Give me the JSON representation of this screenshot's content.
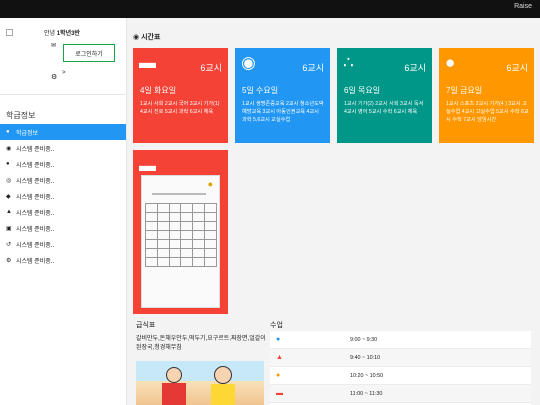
{
  "topbar": {
    "brand": "Raise"
  },
  "sidebar": {
    "greeting_prefix": "안녕 ",
    "greeting_bold": "1학년3반",
    "login_label": "로그인하기",
    "chevron": ">",
    "section_title": "학급정보",
    "menu": [
      {
        "label": "학급정보",
        "icon": "users-icon",
        "glyph": "●",
        "active": true
      },
      {
        "label": "시스템 준비중..",
        "icon": "eye-icon",
        "glyph": "◉"
      },
      {
        "label": "시스템 준비중..",
        "icon": "users-icon",
        "glyph": "●"
      },
      {
        "label": "시스템 준비중..",
        "icon": "compass-icon",
        "glyph": "◎"
      },
      {
        "label": "시스템 준비중..",
        "icon": "diamond-icon",
        "glyph": "◆"
      },
      {
        "label": "시스템 준비중..",
        "icon": "bell-icon",
        "glyph": "▲"
      },
      {
        "label": "시스템 준비중..",
        "icon": "bank-icon",
        "glyph": "▣"
      },
      {
        "label": "시스템 준비중..",
        "icon": "history-icon",
        "glyph": "↺"
      },
      {
        "label": "시스템 준비중..",
        "icon": "gear-icon",
        "glyph": "⚙"
      }
    ]
  },
  "main": {
    "title": "시간표",
    "cards": [
      {
        "color": "#f44336",
        "icon": "comment-icon",
        "glyph": "▬",
        "periods": "6교시",
        "day": "4일 화요일",
        "detail": "1교시 사회 2교시 국어 3교시 기가(1) 4교시 진로 5교시 과학 6교시 체육"
      },
      {
        "color": "#2196f3",
        "icon": "eye-icon",
        "glyph": "◉",
        "periods": "6교시",
        "day": "5일 수요일",
        "detail": "1교시 생명존중교육 2교시 청소년도박예방교육 3교시 아동인권교육 4교시 과학 5,6교시 교실수업"
      },
      {
        "color": "#009688",
        "icon": "share-icon",
        "glyph": "∴",
        "periods": "6교시",
        "day": "6일 목요일",
        "detail": "1교시 기가(2) 2교시 사회 3교시 독서 4교시 영어 5교시 수학 6교시 체육"
      },
      {
        "color": "#ff9800",
        "icon": "users-icon",
        "glyph": "●",
        "periods": "6교시",
        "day": "7일 금요일",
        "detail": "1교시 스포츠 2교시 기가(4 ) 3교시 고실수업 4교시 고실수업 5교시 수학 6교시 수학 7교시 담임시간"
      }
    ],
    "lunch": {
      "title": "급식표",
      "menu": "갈비만두,돈채우만두,떡두기,요구르트,짜장면,얼갈이된장국,청경채무침"
    },
    "classes": {
      "title": "수업",
      "items": [
        {
          "time": "9:00 ~ 9:30",
          "icon": "user-icon",
          "glyph": "●",
          "color": "#2196f3"
        },
        {
          "time": "9:40 ~ 10:10",
          "icon": "bell-icon",
          "glyph": "▲",
          "color": "#f44336"
        },
        {
          "time": "10:20 ~ 10:50",
          "icon": "users-icon",
          "glyph": "●",
          "color": "#ff9800"
        },
        {
          "time": "11:00 ~ 11:30",
          "icon": "comment-icon",
          "glyph": "▬",
          "color": "#f44336"
        },
        {
          "time": "",
          "icon": "user-icon",
          "glyph": "●",
          "color": "#2196f3"
        }
      ]
    }
  }
}
